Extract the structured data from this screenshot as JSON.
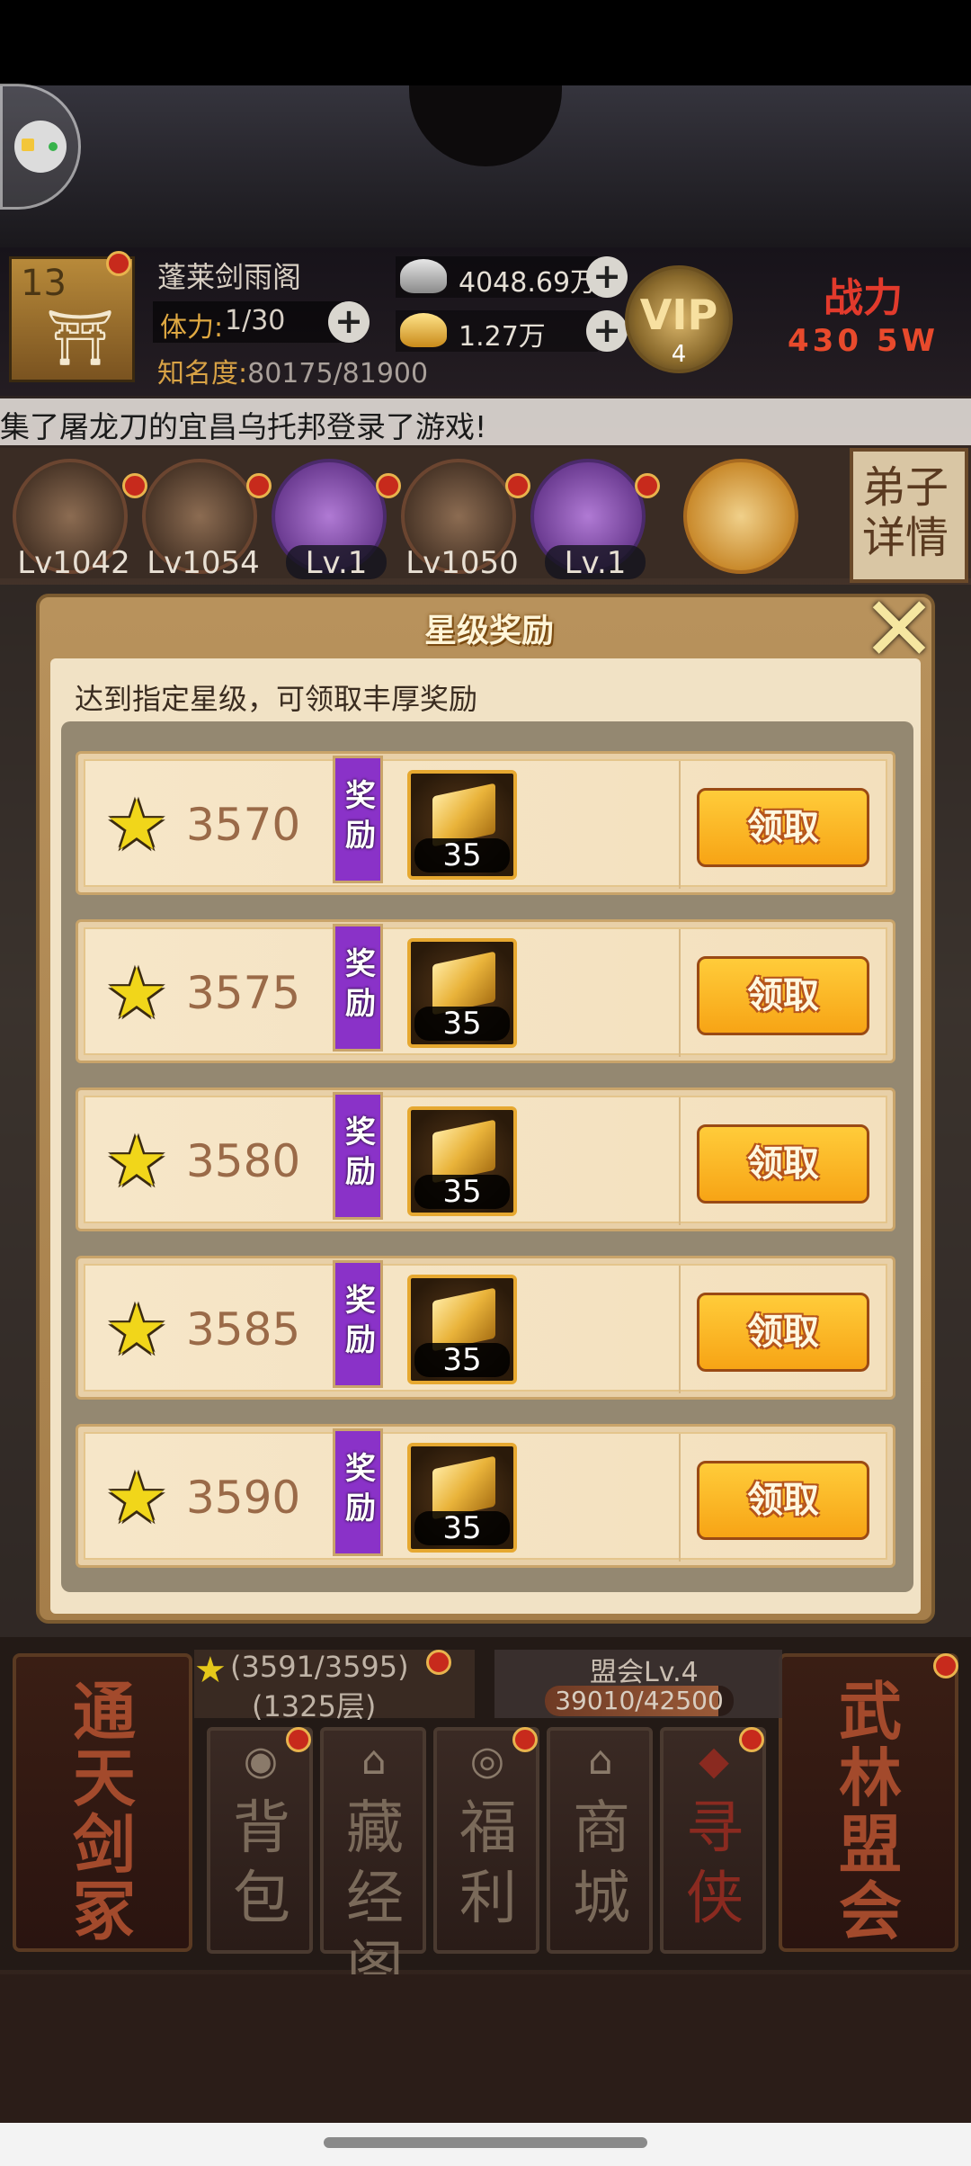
{
  "player": {
    "level": "13",
    "name": "蓬莱剑雨阁",
    "stamina_label": "体力:",
    "stamina_value": "1/30",
    "fame_label": "知名度:",
    "fame_value": "80175/81900",
    "silver": "4048.69万",
    "gold": "1.27万",
    "vip_label": "VIP",
    "vip_level": "4",
    "power_label": "战力",
    "power_value": "430 5W"
  },
  "marquee": "集了屠龙刀的宜昌乌托邦登录了游戏!",
  "disciples": [
    {
      "level": "Lv1042"
    },
    {
      "level": "Lv1054"
    },
    {
      "level": "Lv.1"
    },
    {
      "level": "Lv1050"
    },
    {
      "level": "Lv.1"
    },
    {
      "level": ""
    }
  ],
  "detail_button": "弟子详情",
  "dialog": {
    "title": "星级奖励",
    "description": "达到指定星级，可领取丰厚奖励",
    "tag_label": "奖励",
    "claim_label": "领取",
    "rows": [
      {
        "stars": "3570",
        "quantity": "35"
      },
      {
        "stars": "3575",
        "quantity": "35"
      },
      {
        "stars": "3580",
        "quantity": "35"
      },
      {
        "stars": "3585",
        "quantity": "35"
      },
      {
        "stars": "3590",
        "quantity": "35"
      }
    ]
  },
  "bottom": {
    "left_big": "通天剑冢",
    "right_big": "武林盟会",
    "star_progress": "(3591/3595)",
    "floor": "(1325层)",
    "guild_title": "盟会Lv.4",
    "guild_progress": "39010/42500",
    "guild_fraction": 0.918,
    "menu": [
      {
        "label": "背包",
        "icon": "bag-icon"
      },
      {
        "label": "藏经阁",
        "icon": "pavilion-icon"
      },
      {
        "label": "福利",
        "icon": "coin-icon"
      },
      {
        "label": "商城",
        "icon": "shop-icon"
      },
      {
        "label": "寻侠",
        "icon": "seek-icon"
      }
    ]
  },
  "colors": {
    "claim_button": "#f7a415",
    "reward_tag": "#8a32c8",
    "star": "#f1d61a"
  }
}
